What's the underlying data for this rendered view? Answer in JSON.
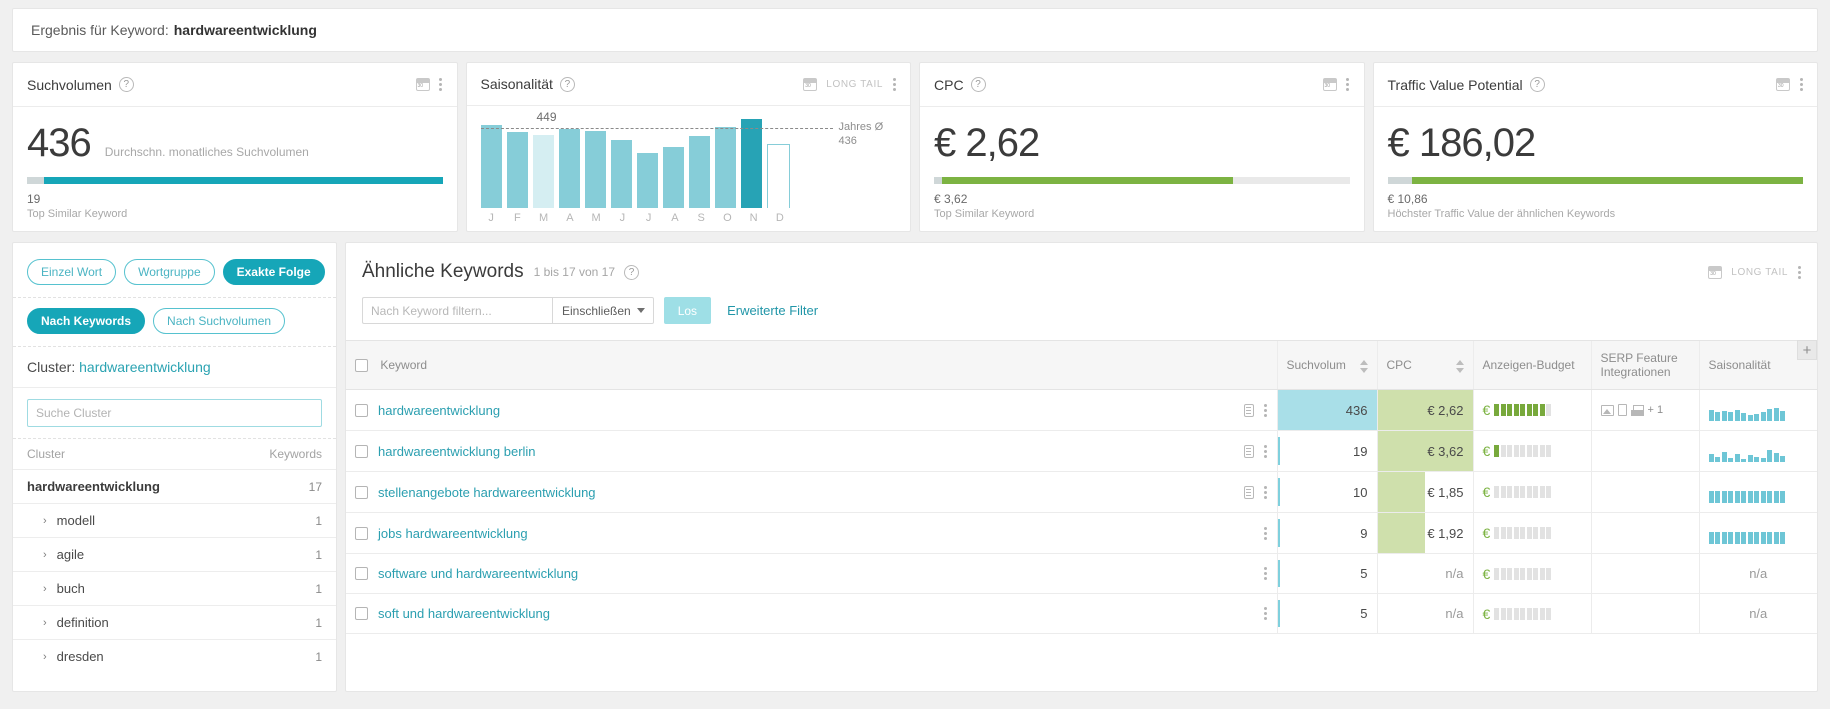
{
  "header": {
    "result_label": "Ergebnis für Keyword:",
    "keyword": "hardwareentwicklung"
  },
  "cards": {
    "search_volume": {
      "title": "Suchvolumen",
      "value": "436",
      "value_caption": "Durchschn. monatliches Suchvolumen",
      "foot_value": "19",
      "foot_label": "Top Similar Keyword",
      "bar_fill_pct": 100,
      "bar_marker_pct": 4,
      "accent": "#16a6b8"
    },
    "seasonality": {
      "title": "Saisonalität",
      "longtail_badge": "LONG TAIL",
      "peak_label": "449",
      "avg_label_line1": "Jahres Ø",
      "avg_label_line2": "436"
    },
    "cpc": {
      "title": "CPC",
      "value": "€ 2,62",
      "foot_value": "€ 3,62",
      "foot_label": "Top Similar Keyword",
      "bar_fill_pct": 72,
      "bar_marker_pct": 2,
      "accent": "#7cb342"
    },
    "traffic_value": {
      "title": "Traffic Value Potential",
      "value": "€ 186,02",
      "foot_value": "€ 10,86",
      "foot_label": "Höchster Traffic Value der ähnlichen Keywords",
      "bar_fill_pct": 100,
      "bar_marker_pct": 6,
      "accent": "#7cb342"
    }
  },
  "chart_data": {
    "type": "bar",
    "title": "Saisonalität",
    "categories": [
      "J",
      "F",
      "M",
      "A",
      "M",
      "J",
      "J",
      "A",
      "S",
      "O",
      "N",
      "D"
    ],
    "values": [
      449,
      410,
      395,
      430,
      415,
      370,
      300,
      330,
      390,
      440,
      480,
      345
    ],
    "annotations": {
      "peak_value_label": "449",
      "average_label": "Jahres Ø",
      "average_value": "436"
    },
    "bar_styles": [
      "normal",
      "normal",
      "light",
      "normal",
      "normal",
      "normal",
      "normal",
      "normal",
      "normal",
      "normal",
      "dark",
      "outline"
    ],
    "ylim": [
      0,
      520
    ],
    "grid": false,
    "xlabel": "",
    "ylabel": ""
  },
  "cluster_panel": {
    "mode_pills": [
      {
        "label": "Einzel Wort",
        "active": false
      },
      {
        "label": "Wortgruppe",
        "active": false
      },
      {
        "label": "Exakte Folge",
        "active": true
      }
    ],
    "sort_pills": [
      {
        "label": "Nach Keywords",
        "active": true
      },
      {
        "label": "Nach Suchvolumen",
        "active": false
      }
    ],
    "cluster_label": "Cluster:",
    "cluster_value": "hardwareentwicklung",
    "search_placeholder": "Suche Cluster",
    "search_value": "",
    "col_cluster": "Cluster",
    "col_keywords": "Keywords",
    "rows": [
      {
        "label": "hardwareentwicklung",
        "count": "17",
        "root": true
      },
      {
        "label": "modell",
        "count": "1",
        "root": false
      },
      {
        "label": "agile",
        "count": "1",
        "root": false
      },
      {
        "label": "buch",
        "count": "1",
        "root": false
      },
      {
        "label": "definition",
        "count": "1",
        "root": false
      },
      {
        "label": "dresden",
        "count": "1",
        "root": false
      }
    ]
  },
  "keywords_panel": {
    "title": "Ähnliche Keywords",
    "count_text": "1 bis 17 von 17",
    "longtail_badge": "LONG TAIL",
    "filter_placeholder": "Nach Keyword filtern...",
    "filter_value": "",
    "select_value": "Einschließen",
    "go_label": "Los",
    "advanced_link": "Erweiterte Filter",
    "columns": [
      "Keyword",
      "Suchvolum",
      "CPC",
      "Anzeigen-Budget",
      "SERP Feature Integrationen",
      "Saisonalität"
    ],
    "rows": [
      {
        "keyword": "hardwareentwicklung",
        "has_doc_icon": true,
        "volume": "436",
        "volume_bar_pct": 100,
        "cpc": "€ 2,62",
        "cpc_bar_pct": 100,
        "budget_filled": 8,
        "serp": [
          "image-icon",
          "panel-icon",
          "shopping-icon"
        ],
        "serp_more": "+ 1",
        "season": [
          11,
          9,
          10,
          9,
          11,
          8,
          6,
          7,
          9,
          12,
          13,
          10
        ]
      },
      {
        "keyword": "hardwareentwicklung berlin",
        "has_doc_icon": true,
        "volume": "19",
        "volume_bar_pct": 0,
        "cpc": "€ 3,62",
        "cpc_bar_pct": 100,
        "budget_filled": 1,
        "serp": [],
        "serp_more": "",
        "season": [
          8,
          5,
          10,
          4,
          8,
          3,
          7,
          5,
          4,
          12,
          9,
          6
        ]
      },
      {
        "keyword": "stellenangebote hardwareentwicklung",
        "has_doc_icon": true,
        "volume": "10",
        "volume_bar_pct": 0,
        "cpc": "€ 1,85",
        "cpc_bar_pct": 50,
        "budget_filled": 0,
        "serp": [],
        "serp_more": "",
        "season": [
          12,
          12,
          12,
          12,
          12,
          12,
          12,
          12,
          12,
          12,
          12,
          12
        ]
      },
      {
        "keyword": "jobs hardwareentwicklung",
        "has_doc_icon": false,
        "volume": "9",
        "volume_bar_pct": 0,
        "cpc": "€ 1,92",
        "cpc_bar_pct": 50,
        "budget_filled": 0,
        "serp": [],
        "serp_more": "",
        "season": [
          12,
          12,
          12,
          12,
          12,
          12,
          12,
          12,
          12,
          12,
          12,
          12
        ]
      },
      {
        "keyword": "software und hardwareentwicklung",
        "has_doc_icon": false,
        "volume": "5",
        "volume_bar_pct": 0,
        "cpc": "n/a",
        "cpc_bar_pct": 0,
        "budget_filled": 0,
        "serp": [],
        "serp_more": "",
        "season": [],
        "season_na": "n/a"
      },
      {
        "keyword": "soft und hardwareentwicklung",
        "has_doc_icon": false,
        "volume": "5",
        "volume_bar_pct": 0,
        "cpc": "n/a",
        "cpc_bar_pct": 0,
        "budget_filled": 0,
        "serp": [],
        "serp_more": "",
        "season": [],
        "season_na": "n/a"
      }
    ],
    "add_column_label": "+"
  }
}
